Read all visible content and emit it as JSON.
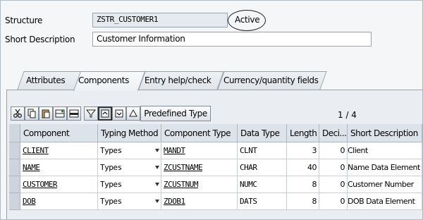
{
  "header": {
    "structure_label": "Structure",
    "structure_value": "ZSTR_CUSTOMER1",
    "status": "Active",
    "short_desc_label": "Short Description",
    "short_desc_value": "Customer Information"
  },
  "tabs": [
    {
      "label": "Attributes",
      "active": false
    },
    {
      "label": "Components",
      "active": true
    },
    {
      "label": "Entry help/check",
      "active": false
    },
    {
      "label": "Currency/quantity fields",
      "active": false
    }
  ],
  "toolbar": {
    "icons": [
      "cut-icon",
      "copy-icon",
      "paste-icon",
      "insert-row-icon",
      "delete-row-icon",
      "filter-icon",
      "move-up-icon",
      "move-down-icon",
      "sort-icon"
    ],
    "predefined_type_label": "Predefined Type",
    "pager": "1  /  4"
  },
  "table": {
    "columns": [
      "Component",
      "Typing Method",
      "Component Type",
      "Data Type",
      "Length",
      "Deci...",
      "Short Description"
    ],
    "rows": [
      {
        "component": "CLIENT",
        "typing": "Types",
        "comp_type": "MANDT",
        "data_type": "CLNT",
        "length": "3",
        "decimals": "0",
        "desc": "Client"
      },
      {
        "component": "NAME",
        "typing": "Types",
        "comp_type": "ZCUSTNAME",
        "data_type": "CHAR",
        "length": "40",
        "decimals": "0",
        "desc": "Name Data Element"
      },
      {
        "component": "CUSTOMER",
        "typing": "Types",
        "comp_type": "ZCUSTNUM",
        "data_type": "NUMC",
        "length": "8",
        "decimals": "0",
        "desc": "Customer Number"
      },
      {
        "component": "DOB",
        "typing": "Types",
        "comp_type": "ZDOB1",
        "data_type": "DATS",
        "length": "8",
        "decimals": "0",
        "desc": "DOB Data Element"
      }
    ]
  }
}
